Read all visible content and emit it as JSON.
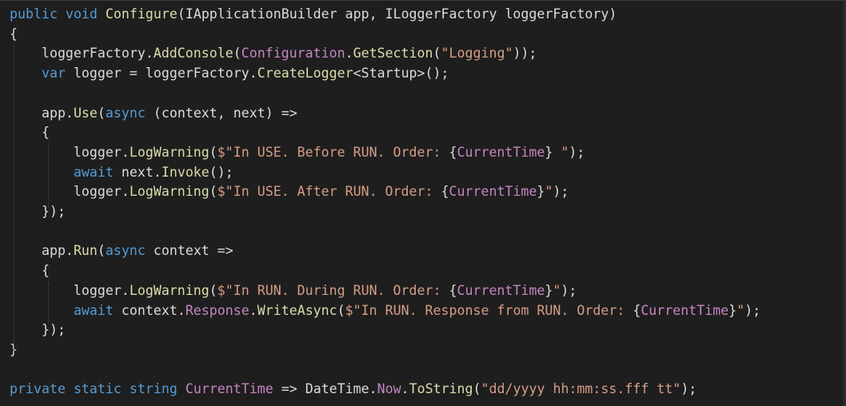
{
  "editor": {
    "lines": [
      {
        "tokens": [
          {
            "t": "public",
            "c": "kw"
          },
          {
            "t": " ",
            "c": "pl"
          },
          {
            "t": "void",
            "c": "kw"
          },
          {
            "t": " ",
            "c": "pl"
          },
          {
            "t": "Configure",
            "c": "fn"
          },
          {
            "t": "(IApplicationBuilder app, ILoggerFactory loggerFactory)",
            "c": "pl"
          }
        ]
      },
      {
        "tokens": [
          {
            "t": "{",
            "c": "pl"
          }
        ]
      },
      {
        "tokens": [
          {
            "t": "    loggerFactory.",
            "c": "pl"
          },
          {
            "t": "AddConsole",
            "c": "fn"
          },
          {
            "t": "(",
            "c": "pl"
          },
          {
            "t": "Configuration",
            "c": "ip"
          },
          {
            "t": ".",
            "c": "pl"
          },
          {
            "t": "GetSection",
            "c": "fn"
          },
          {
            "t": "(",
            "c": "pl"
          },
          {
            "t": "\"Logging\"",
            "c": "st"
          },
          {
            "t": "));",
            "c": "pl"
          }
        ]
      },
      {
        "tokens": [
          {
            "t": "    ",
            "c": "pl"
          },
          {
            "t": "var",
            "c": "kw"
          },
          {
            "t": " logger = loggerFactory.",
            "c": "pl"
          },
          {
            "t": "CreateLogger",
            "c": "fn"
          },
          {
            "t": "<Startup>();",
            "c": "pl"
          }
        ]
      },
      {
        "tokens": [
          {
            "t": "",
            "c": "pl"
          }
        ]
      },
      {
        "tokens": [
          {
            "t": "    app.",
            "c": "pl"
          },
          {
            "t": "Use",
            "c": "fn"
          },
          {
            "t": "(",
            "c": "pl"
          },
          {
            "t": "async",
            "c": "kw"
          },
          {
            "t": " (context, next) =>",
            "c": "pl"
          }
        ]
      },
      {
        "tokens": [
          {
            "t": "    {",
            "c": "pl"
          }
        ]
      },
      {
        "tokens": [
          {
            "t": "        logger.",
            "c": "pl"
          },
          {
            "t": "LogWarning",
            "c": "fn"
          },
          {
            "t": "(",
            "c": "pl"
          },
          {
            "t": "$\"In USE. Before RUN. Order: ",
            "c": "st"
          },
          {
            "t": "{",
            "c": "pl"
          },
          {
            "t": "CurrentTime",
            "c": "ip"
          },
          {
            "t": "}",
            "c": "pl"
          },
          {
            "t": " \"",
            "c": "st"
          },
          {
            "t": ");",
            "c": "pl"
          }
        ]
      },
      {
        "tokens": [
          {
            "t": "        ",
            "c": "pl"
          },
          {
            "t": "await",
            "c": "kw"
          },
          {
            "t": " next.",
            "c": "pl"
          },
          {
            "t": "Invoke",
            "c": "fn"
          },
          {
            "t": "();",
            "c": "pl"
          }
        ]
      },
      {
        "tokens": [
          {
            "t": "        logger.",
            "c": "pl"
          },
          {
            "t": "LogWarning",
            "c": "fn"
          },
          {
            "t": "(",
            "c": "pl"
          },
          {
            "t": "$\"In USE. After RUN. Order: ",
            "c": "st"
          },
          {
            "t": "{",
            "c": "pl"
          },
          {
            "t": "CurrentTime",
            "c": "ip"
          },
          {
            "t": "}",
            "c": "pl"
          },
          {
            "t": "\"",
            "c": "st"
          },
          {
            "t": ");",
            "c": "pl"
          }
        ]
      },
      {
        "tokens": [
          {
            "t": "    });",
            "c": "pl"
          }
        ]
      },
      {
        "tokens": [
          {
            "t": "",
            "c": "pl"
          }
        ]
      },
      {
        "tokens": [
          {
            "t": "    app.",
            "c": "pl"
          },
          {
            "t": "Run",
            "c": "fn"
          },
          {
            "t": "(",
            "c": "pl"
          },
          {
            "t": "async",
            "c": "kw"
          },
          {
            "t": " context =>",
            "c": "pl"
          }
        ]
      },
      {
        "tokens": [
          {
            "t": "    {",
            "c": "pl"
          }
        ]
      },
      {
        "tokens": [
          {
            "t": "        logger.",
            "c": "pl"
          },
          {
            "t": "LogWarning",
            "c": "fn"
          },
          {
            "t": "(",
            "c": "pl"
          },
          {
            "t": "$\"In RUN. During RUN. Order: ",
            "c": "st"
          },
          {
            "t": "{",
            "c": "pl"
          },
          {
            "t": "CurrentTime",
            "c": "ip"
          },
          {
            "t": "}",
            "c": "pl"
          },
          {
            "t": "\"",
            "c": "st"
          },
          {
            "t": ");",
            "c": "pl"
          }
        ]
      },
      {
        "tokens": [
          {
            "t": "        ",
            "c": "pl"
          },
          {
            "t": "await",
            "c": "kw"
          },
          {
            "t": " context.",
            "c": "pl"
          },
          {
            "t": "Response",
            "c": "ip"
          },
          {
            "t": ".",
            "c": "pl"
          },
          {
            "t": "WriteAsync",
            "c": "fn"
          },
          {
            "t": "(",
            "c": "pl"
          },
          {
            "t": "$\"In RUN. Response from RUN. Order: ",
            "c": "st"
          },
          {
            "t": "{",
            "c": "pl"
          },
          {
            "t": "CurrentTime",
            "c": "ip"
          },
          {
            "t": "}",
            "c": "pl"
          },
          {
            "t": "\"",
            "c": "st"
          },
          {
            "t": ");",
            "c": "pl"
          }
        ]
      },
      {
        "tokens": [
          {
            "t": "    });",
            "c": "pl"
          }
        ]
      },
      {
        "tokens": [
          {
            "t": "}",
            "c": "pl"
          }
        ]
      },
      {
        "tokens": [
          {
            "t": "",
            "c": "pl"
          }
        ]
      },
      {
        "tokens": [
          {
            "t": "private",
            "c": "kw"
          },
          {
            "t": " ",
            "c": "pl"
          },
          {
            "t": "static",
            "c": "kw"
          },
          {
            "t": " ",
            "c": "pl"
          },
          {
            "t": "string",
            "c": "kw"
          },
          {
            "t": " ",
            "c": "pl"
          },
          {
            "t": "CurrentTime",
            "c": "ip"
          },
          {
            "t": " => DateTime.",
            "c": "pl"
          },
          {
            "t": "Now",
            "c": "ip"
          },
          {
            "t": ".",
            "c": "pl"
          },
          {
            "t": "ToString",
            "c": "fn"
          },
          {
            "t": "(",
            "c": "pl"
          },
          {
            "t": "\"dd/yyyy hh:mm:ss.fff tt\"",
            "c": "st"
          },
          {
            "t": ");",
            "c": "pl"
          }
        ]
      }
    ]
  }
}
